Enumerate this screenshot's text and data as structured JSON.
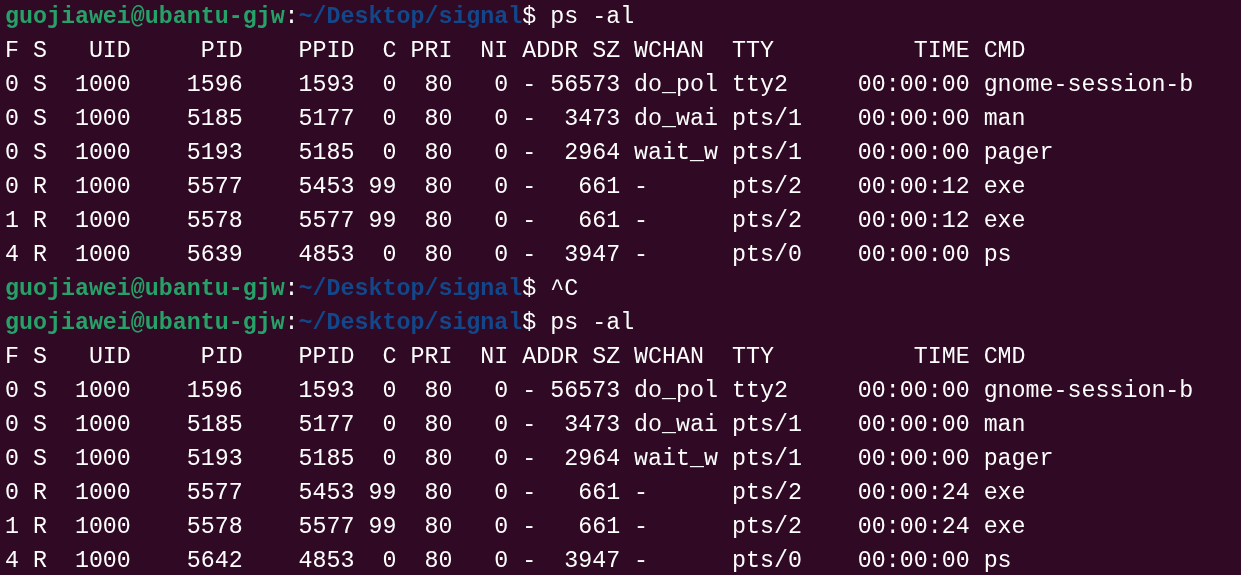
{
  "terminal": {
    "lines": [
      {
        "kind": "prompt",
        "user_host": "guojiawei@ubantu-gjw",
        "separator": ":",
        "path": "~/Desktop/signal",
        "symbol": "$",
        "command": "ps -al"
      },
      {
        "kind": "output",
        "text": "F S   UID     PID    PPID  C PRI  NI ADDR SZ WCHAN  TTY          TIME CMD"
      },
      {
        "kind": "output",
        "text": "0 S  1000    1596    1593  0  80   0 - 56573 do_pol tty2     00:00:00 gnome-session-b"
      },
      {
        "kind": "output",
        "text": "0 S  1000    5185    5177  0  80   0 -  3473 do_wai pts/1    00:00:00 man"
      },
      {
        "kind": "output",
        "text": "0 S  1000    5193    5185  0  80   0 -  2964 wait_w pts/1    00:00:00 pager"
      },
      {
        "kind": "output",
        "text": "0 R  1000    5577    5453 99  80   0 -   661 -      pts/2    00:00:12 exe"
      },
      {
        "kind": "output",
        "text": "1 R  1000    5578    5577 99  80   0 -   661 -      pts/2    00:00:12 exe"
      },
      {
        "kind": "output",
        "text": "4 R  1000    5639    4853  0  80   0 -  3947 -      pts/0    00:00:00 ps"
      },
      {
        "kind": "prompt",
        "user_host": "guojiawei@ubantu-gjw",
        "separator": ":",
        "path": "~/Desktop/signal",
        "symbol": "$",
        "command": "^C"
      },
      {
        "kind": "prompt",
        "user_host": "guojiawei@ubantu-gjw",
        "separator": ":",
        "path": "~/Desktop/signal",
        "symbol": "$",
        "command": "ps -al"
      },
      {
        "kind": "output",
        "text": "F S   UID     PID    PPID  C PRI  NI ADDR SZ WCHAN  TTY          TIME CMD"
      },
      {
        "kind": "output",
        "text": "0 S  1000    1596    1593  0  80   0 - 56573 do_pol tty2     00:00:00 gnome-session-b"
      },
      {
        "kind": "output",
        "text": "0 S  1000    5185    5177  0  80   0 -  3473 do_wai pts/1    00:00:00 man"
      },
      {
        "kind": "output",
        "text": "0 S  1000    5193    5185  0  80   0 -  2964 wait_w pts/1    00:00:00 pager"
      },
      {
        "kind": "output",
        "text": "0 R  1000    5577    5453 99  80   0 -   661 -      pts/2    00:00:24 exe"
      },
      {
        "kind": "output",
        "text": "1 R  1000    5578    5577 99  80   0 -   661 -      pts/2    00:00:24 exe"
      },
      {
        "kind": "output",
        "text": "4 R  1000    5642    4853  0  80   0 -  3947 -      pts/0    00:00:00 ps"
      }
    ]
  }
}
